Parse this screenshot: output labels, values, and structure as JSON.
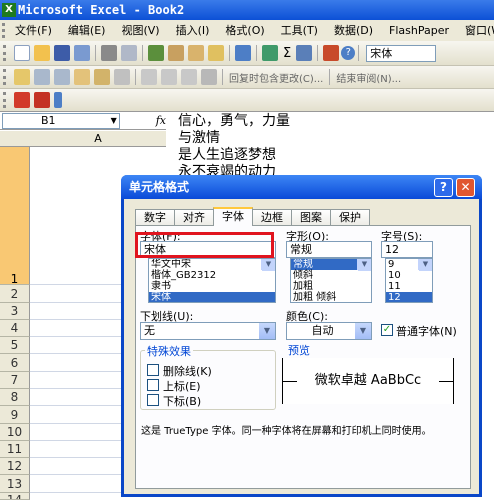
{
  "window": {
    "title": "Microsoft Excel - Book2",
    "app_icon_letter": "X"
  },
  "menu": [
    "文件(F)",
    "编辑(E)",
    "视图(V)",
    "插入(I)",
    "格式(O)",
    "工具(T)",
    "数据(D)",
    "FlashPaper",
    "窗口(W)"
  ],
  "toolbar": {
    "font_name": "宋体",
    "sigma": "Σ",
    "zoom_symbol": "?"
  },
  "review_toolbar": {
    "reply_label": "回复时包含更改(C)...",
    "end_review_label": "结束审阅(N)..."
  },
  "formula_bar": {
    "name_box": "B1",
    "fx": "fx"
  },
  "sheet": {
    "column_a": "A",
    "rows": [
      "1",
      "2",
      "3",
      "4",
      "5",
      "6",
      "7",
      "8",
      "9",
      "10",
      "11",
      "12",
      "13",
      "14"
    ],
    "cell_lines": [
      "信心，勇气，力量",
      "与激情",
      "是人生追逐梦想",
      "永不衰竭的动力"
    ]
  },
  "dialog": {
    "title": "单元格格式",
    "help": "?",
    "close": "✕",
    "tabs": [
      "数字",
      "对齐",
      "字体",
      "边框",
      "图案",
      "保护"
    ],
    "active_tab": "字体",
    "font": {
      "label": "字体(F):",
      "value": "宋体",
      "list": [
        "华文中宋",
        "楷体_GB2312",
        "隶书",
        "宋体"
      ],
      "selected": "宋体"
    },
    "style": {
      "label": "字形(O):",
      "value": "常规",
      "list": [
        "常规",
        "倾斜",
        "加粗",
        "加粗 倾斜"
      ],
      "selected": "常规"
    },
    "size": {
      "label": "字号(S):",
      "value": "12",
      "list": [
        "9",
        "10",
        "11",
        "12"
      ],
      "selected": "12"
    },
    "underline": {
      "label": "下划线(U):",
      "value": "无"
    },
    "color": {
      "label": "颜色(C):",
      "value": "自动"
    },
    "normal_font": {
      "label": "普通字体(N)",
      "checked": true
    },
    "effects": {
      "label": "特殊效果",
      "items": [
        "删除线(K)",
        "上标(E)",
        "下标(B)"
      ]
    },
    "preview": {
      "label": "预览",
      "text": "微软卓越  AaBbCc"
    },
    "info": "这是 TrueType 字体。同一种字体将在屏幕和打印机上同时使用。",
    "highlight_color": "#e0141e"
  }
}
